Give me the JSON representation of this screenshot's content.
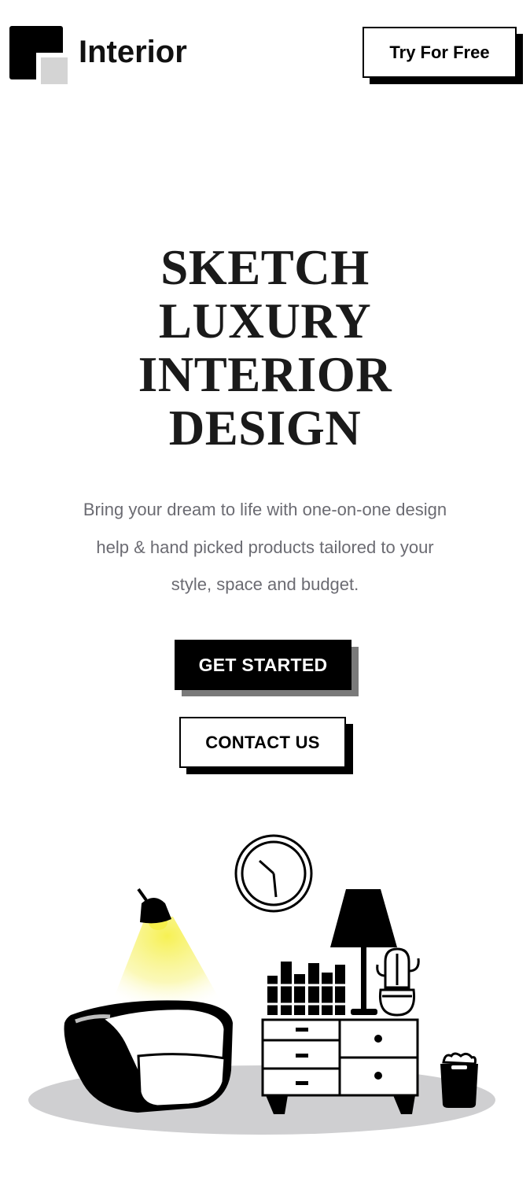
{
  "header": {
    "brand": "Interior",
    "logo_icon": "logo-square-icon",
    "cta_label": "Try For Free"
  },
  "hero": {
    "headline_lines": [
      "SKETCH",
      "LUXURY",
      "INTERIOR",
      "DESIGN"
    ],
    "subtitle_lines": [
      "Bring your dream to life with one-on-one design",
      "help & hand picked products tailored to your",
      "style, space and budget."
    ],
    "primary_button": "GET STARTED",
    "secondary_button": "CONTACT US"
  },
  "illustration": {
    "objects": [
      "clock-icon",
      "ceiling-lamp-icon",
      "armchair-icon",
      "table-lamp-icon",
      "cactus-plant-icon",
      "bookshelf-books-icon",
      "dresser-icon",
      "trash-bin-icon",
      "floor-shadow"
    ]
  },
  "colors": {
    "primary": "#000000",
    "text_gray": "#6b6b72",
    "accent_yellow": "#f6f04a",
    "floor_gray": "#cfcfd1"
  }
}
